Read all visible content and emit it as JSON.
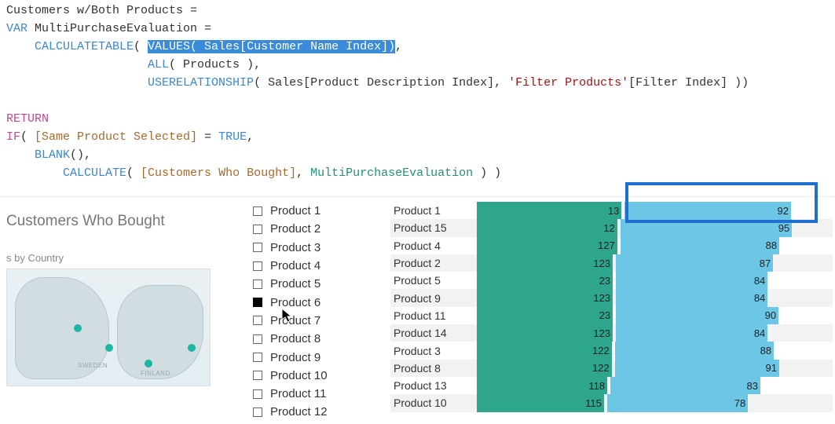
{
  "dax": {
    "l1a": "Customers w/Both Products ",
    "l1b": "=",
    "l2a": "VAR",
    "l2b": " MultiPurchaseEvaluation ",
    "l2c": "=",
    "l3a": "    CALCULATETABLE",
    "l3b": "( ",
    "l3hl": "VALUES( Sales[Customer Name Index])",
    "l3c": ",",
    "l4a": "                    ",
    "l4b": "ALL",
    "l4c": "( Products ),",
    "l5a": "                    ",
    "l5b": "USERELATIONSHIP",
    "l5c": "( Sales[Product Description Index], ",
    "l5d": "'Filter Products'",
    "l5e": "[Filter Index] ))",
    "l6": "",
    "l7": "RETURN",
    "l8a": "IF",
    "l8b": "( ",
    "l8c": "[Same Product Selected]",
    "l8d": " = ",
    "l8e": "TRUE",
    "l8f": ",",
    "l9a": "    ",
    "l9b": "BLANK",
    "l9c": "(),",
    "l10a": "        ",
    "l10b": "CALCULATE",
    "l10c": "( ",
    "l10d": "[Customers Who Bought]",
    "l10e": ", ",
    "l10f": "MultiPurchaseEvaluation",
    "l10g": " ) )"
  },
  "left": {
    "title": "Customers Who Bought",
    "sub": "s by Country",
    "labels": {
      "sweden": "SWEDEN",
      "finland": "FINLAND"
    }
  },
  "slicer": [
    {
      "label": "Product 1",
      "checked": false
    },
    {
      "label": "Product 2",
      "checked": false
    },
    {
      "label": "Product 3",
      "checked": false
    },
    {
      "label": "Product 4",
      "checked": false
    },
    {
      "label": "Product 5",
      "checked": false
    },
    {
      "label": "Product 6",
      "checked": true
    },
    {
      "label": "Product 7",
      "checked": false
    },
    {
      "label": "Product 8",
      "checked": false
    },
    {
      "label": "Product 9",
      "checked": false
    },
    {
      "label": "Product 10",
      "checked": false
    },
    {
      "label": "Product 11",
      "checked": false
    },
    {
      "label": "Product 12",
      "checked": false
    }
  ],
  "chart_data": {
    "type": "bar",
    "title": "",
    "xlabel": "",
    "ylabel": "",
    "series_names": [
      "Customers Who Bought",
      "Customers w/Both Products"
    ],
    "rows": [
      {
        "label": "Product 1",
        "a": 131,
        "a_txt": "13",
        "b": 92
      },
      {
        "label": "Product 15",
        "a": 127,
        "a_txt": "12",
        "b": 95
      },
      {
        "label": "Product 4",
        "a": 127,
        "a_txt": "127",
        "b": 88
      },
      {
        "label": "Product 2",
        "a": 123,
        "a_txt": "123",
        "b": 87
      },
      {
        "label": "Product 5",
        "a": 123,
        "a_txt": "23",
        "b": 84
      },
      {
        "label": "Product 9",
        "a": 123,
        "a_txt": "123",
        "b": 84
      },
      {
        "label": "Product 11",
        "a": 123,
        "a_txt": "23",
        "b": 90
      },
      {
        "label": "Product 14",
        "a": 123,
        "a_txt": "123",
        "b": 84
      },
      {
        "label": "Product 3",
        "a": 122,
        "a_txt": "122",
        "b": 88
      },
      {
        "label": "Product 8",
        "a": 122,
        "a_txt": "122",
        "b": 91
      },
      {
        "label": "Product 13",
        "a": 118,
        "a_txt": "118",
        "b": 83
      },
      {
        "label": "Product 10",
        "a": 115,
        "a_txt": "115",
        "b": 78
      }
    ],
    "max_a": 135,
    "max_b": 100
  },
  "colors": {
    "bar_a": "#2ea68d",
    "bar_b": "#6cc6e6",
    "highlight_box": "#1f6fd1"
  }
}
